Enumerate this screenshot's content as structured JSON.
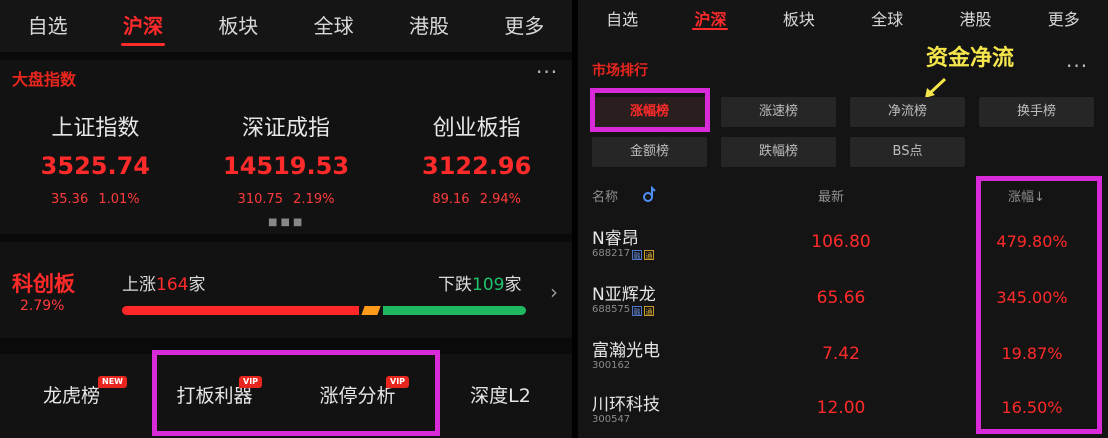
{
  "left": {
    "tabs": [
      {
        "label": "自选",
        "active": false
      },
      {
        "label": "沪深",
        "active": true
      },
      {
        "label": "板块",
        "active": false
      },
      {
        "label": "全球",
        "active": false
      },
      {
        "label": "港股",
        "active": false
      },
      {
        "label": "更多",
        "active": false
      }
    ],
    "section_title": "大盘指数",
    "more": "···",
    "indices": [
      {
        "name": "上证指数",
        "value": "3525.74",
        "change": "35.36 1.01%"
      },
      {
        "name": "深证成指",
        "value": "14519.53",
        "change": "310.75 2.19%"
      },
      {
        "name": "创业板指",
        "value": "3122.96",
        "change": "89.16 2.94%"
      }
    ],
    "pager": "■■■",
    "star_market": {
      "title": "科创板",
      "change": "2.79%",
      "rise_prefix": "上涨",
      "rise_count": "164",
      "rise_suffix": "家",
      "fall_prefix": "下跌",
      "fall_count": "109",
      "fall_suffix": "家",
      "rise_share": 0.6,
      "flat_share": 0.04,
      "fall_share": 0.36,
      "chevron": "›"
    },
    "tools": [
      {
        "label": "龙虎榜",
        "badge": "NEW"
      },
      {
        "label": "打板利器",
        "badge": "VIP"
      },
      {
        "label": "涨停分析",
        "badge": "VIP"
      },
      {
        "label": "深度L2",
        "badge": ""
      }
    ]
  },
  "right": {
    "tabs": [
      {
        "label": "自选",
        "active": false
      },
      {
        "label": "沪深",
        "active": true
      },
      {
        "label": "板块",
        "active": false
      },
      {
        "label": "全球",
        "active": false
      },
      {
        "label": "港股",
        "active": false
      },
      {
        "label": "更多",
        "active": false
      }
    ],
    "section_title": "市场排行",
    "annotation": "资金净流",
    "more": "···",
    "chips": [
      {
        "label": "涨幅榜",
        "active": true
      },
      {
        "label": "涨速榜",
        "active": false
      },
      {
        "label": "净流榜",
        "active": false
      },
      {
        "label": "换手榜",
        "active": false
      },
      {
        "label": "金额榜",
        "active": false
      },
      {
        "label": "跌幅榜",
        "active": false
      },
      {
        "label": "BS点",
        "active": false
      }
    ],
    "headers": {
      "name": "名称",
      "price": "最新",
      "change": "涨幅↓"
    },
    "stocks": [
      {
        "name": "N睿昂",
        "code": "688217",
        "price": "106.80",
        "change": "479.80%"
      },
      {
        "name": "N亚辉龙",
        "code": "688575",
        "price": "65.66",
        "change": "345.00%"
      },
      {
        "name": "富瀚光电",
        "code": "300162",
        "price": "7.42",
        "change": "19.87%"
      },
      {
        "name": "川环科技",
        "code": "300547",
        "price": "12.00",
        "change": "16.50%"
      }
    ],
    "tag_letters": [
      "融",
      "通"
    ],
    "colors": {
      "up": "#ff2a2a",
      "down": "#1fc26b",
      "highlight": "#d92ad9",
      "annotation": "#f5e64c"
    }
  }
}
